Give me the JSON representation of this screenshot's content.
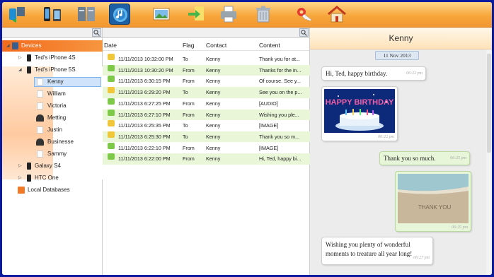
{
  "toolbar": {
    "buttons": [
      {
        "name": "devices-sync-icon"
      },
      {
        "name": "phone-transfer-icon"
      },
      {
        "name": "backup-icon"
      },
      {
        "name": "itunes-icon"
      },
      {
        "name": "photos-icon"
      },
      {
        "name": "export-icon"
      },
      {
        "name": "print-icon"
      },
      {
        "name": "delete-icon"
      },
      {
        "name": "key-icon"
      },
      {
        "name": "home-icon"
      }
    ]
  },
  "tree": {
    "root_label": "Devices",
    "device1_label": "Ted's iPhone 4S",
    "device2_label": "Ted's iPhone 5S",
    "contacts": [
      "Kenny",
      "William",
      "Victoria",
      "Metting",
      "Justin",
      "Businesse",
      "Sammy"
    ],
    "device3_label": "Galaxy S4",
    "device4_label": "HTC One",
    "local_label": "Local Databases"
  },
  "messages": {
    "headers": {
      "date": "Date",
      "flag": "Flag",
      "contact": "Contact",
      "content": "Content"
    },
    "rows": [
      {
        "date": "11/11/2013 10:32:00 PM",
        "flag": "To",
        "contact": "Kenny",
        "content": "Thank you for at..."
      },
      {
        "date": "11/11/2013 10:30:20 PM",
        "flag": "From",
        "contact": "Kenny",
        "content": "Thanks for the in..."
      },
      {
        "date": "11/11/2013 6:30:15 PM",
        "flag": "From",
        "contact": "Kenny",
        "content": "Of course. See y..."
      },
      {
        "date": "11/11/2013 6:29:20 PM",
        "flag": "To",
        "contact": "Kenny",
        "content": "See you on the p..."
      },
      {
        "date": "11/11/2013 6:27:25 PM",
        "flag": "From",
        "contact": "Kenny",
        "content": "[AUDIO]"
      },
      {
        "date": "11/11/2013 6:27:10 PM",
        "flag": "From",
        "contact": "Kenny",
        "content": "Wishing you ple..."
      },
      {
        "date": "11/11/2013 6:25:35 PM",
        "flag": "To",
        "contact": "Kenny",
        "content": "[IMAGE]"
      },
      {
        "date": "11/11/2013 6:25:30 PM",
        "flag": "To",
        "contact": "Kenny",
        "content": "Thank you so m..."
      },
      {
        "date": "11/11/2013 6:22:10 PM",
        "flag": "From",
        "contact": "Kenny",
        "content": "[IMAGE]"
      },
      {
        "date": "11/11/2013 6:22:00 PM",
        "flag": "From",
        "contact": "Kenny",
        "content": "Hi, Ted, happy bi..."
      }
    ]
  },
  "conversation": {
    "title": "Kenny",
    "date": "11 Nov 2013",
    "bubbles": [
      {
        "text": "Hi, Ted, happy birthday.",
        "time": "06:22 pm"
      },
      {
        "image_caption": "HAPPY BIRTHDAY",
        "time": "06:22 pm"
      },
      {
        "text": "Thank you so much.",
        "time": "06:25 pm"
      },
      {
        "image_caption": "THANK YOU",
        "time": "06:25 pm"
      },
      {
        "text": "Wishing you plenty of wonderful moments to treature all year long!",
        "time": "06:27 pm"
      }
    ]
  },
  "colors": {
    "toolbar": "#f7a63c",
    "selected_device": "#f26b1d",
    "alt_row": "#e9f7d8",
    "outgoing_bubble": "#e7f6d8"
  }
}
